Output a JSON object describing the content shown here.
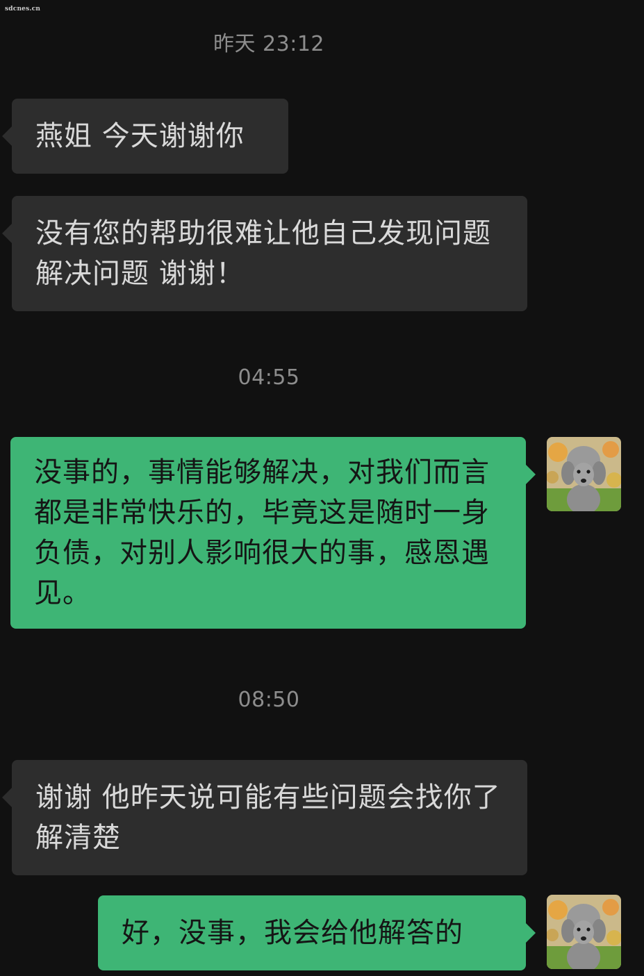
{
  "watermark": "sdcnes.cn",
  "timestamps": [
    "昨天 23:12",
    "04:55",
    "08:50"
  ],
  "messages": [
    {
      "side": "received",
      "text": "燕姐 今天谢谢你"
    },
    {
      "side": "received",
      "text": "没有您的帮助很难让他自己发现问题解决问题 谢谢！"
    },
    {
      "side": "sent",
      "text": "没事的，事情能够解决，对我们而言都是非常快乐的，毕竟这是随时一身负债，对别人影响很大的事，感恩遇见。"
    },
    {
      "side": "received",
      "text": "谢谢 他昨天说可能有些问题会找你了解清楚"
    },
    {
      "side": "sent",
      "text": "好，没事，我会给他解答的"
    }
  ],
  "avatar_icon": "poodle-avatar-icon",
  "colors": {
    "background": "#111111",
    "received_bubble": "#2d2d2d",
    "sent_bubble": "#3eb575",
    "timestamp_text": "#8d8d8d"
  }
}
